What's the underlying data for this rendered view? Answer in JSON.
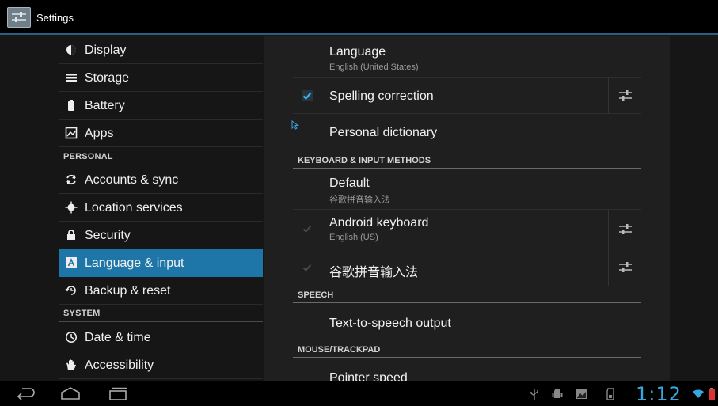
{
  "app": {
    "title": "Settings",
    "icon": "settings-sliders-icon"
  },
  "sidebar": {
    "items": [
      {
        "type": "item",
        "label": "Display",
        "icon": "display-brightness-icon"
      },
      {
        "type": "item",
        "label": "Storage",
        "icon": "storage-icon"
      },
      {
        "type": "item",
        "label": "Battery",
        "icon": "battery-icon"
      },
      {
        "type": "item",
        "label": "Apps",
        "icon": "apps-icon"
      },
      {
        "type": "header",
        "label": "PERSONAL"
      },
      {
        "type": "item",
        "label": "Accounts & sync",
        "icon": "sync-icon"
      },
      {
        "type": "item",
        "label": "Location services",
        "icon": "location-icon"
      },
      {
        "type": "item",
        "label": "Security",
        "icon": "lock-icon"
      },
      {
        "type": "item",
        "label": "Language & input",
        "icon": "language-icon",
        "selected": true
      },
      {
        "type": "item",
        "label": "Backup & reset",
        "icon": "backup-icon"
      },
      {
        "type": "header",
        "label": "SYSTEM"
      },
      {
        "type": "item",
        "label": "Date & time",
        "icon": "clock-icon"
      },
      {
        "type": "item",
        "label": "Accessibility",
        "icon": "hand-icon"
      }
    ]
  },
  "main": {
    "language": {
      "title": "Language",
      "summary": "English (United States)"
    },
    "spelling": {
      "title": "Spelling correction",
      "checked": true
    },
    "dictionary": {
      "title": "Personal dictionary"
    },
    "section_keyboard": "KEYBOARD & INPUT METHODS",
    "default": {
      "title": "Default",
      "summary": "谷歌拼音输入法"
    },
    "android_keyboard": {
      "title": "Android keyboard",
      "summary": "English (US)",
      "checked": true,
      "enabled": false
    },
    "pinyin": {
      "title": "谷歌拼音输入法",
      "checked": true,
      "enabled": false
    },
    "section_speech": "SPEECH",
    "tts": {
      "title": "Text-to-speech output"
    },
    "section_mouse": "MOUSE/TRACKPAD",
    "pointer": {
      "title": "Pointer speed"
    }
  },
  "statusbar": {
    "time": "1:12",
    "icons": [
      "usb-icon",
      "android-debug-icon",
      "image-notification-icon",
      "sd-card-icon",
      "wifi-icon",
      "battery-low-icon"
    ]
  },
  "colors": {
    "accent": "#1e76a8",
    "clock": "#36a7e0"
  }
}
